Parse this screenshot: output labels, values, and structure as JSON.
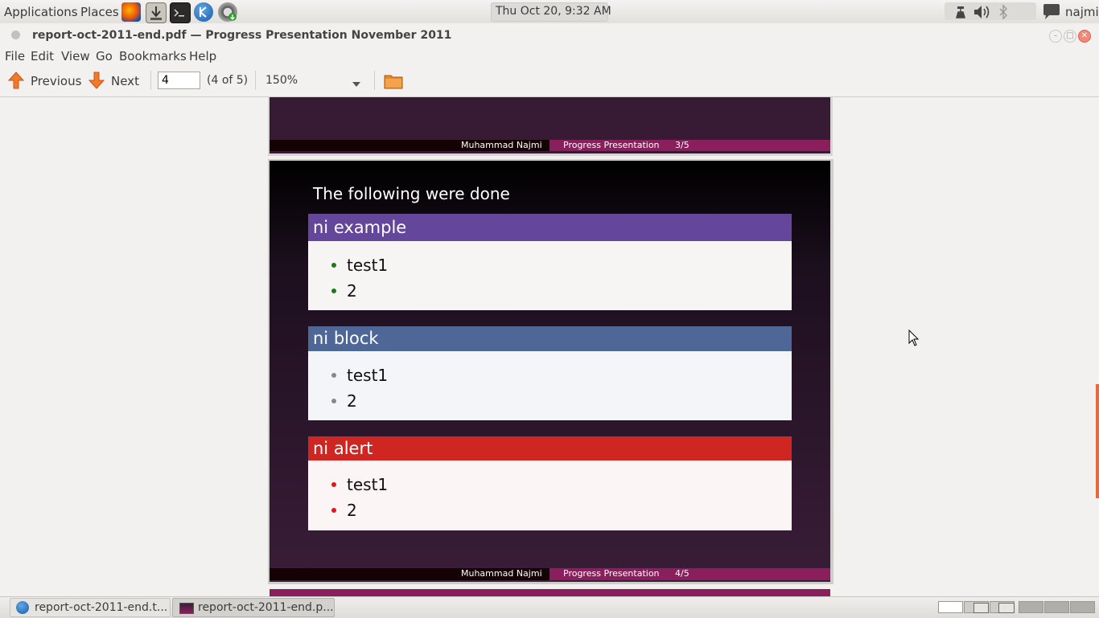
{
  "top_panel": {
    "menus": [
      "Applications",
      "Places"
    ],
    "clock": "Thu Oct 20,  9:32 AM",
    "user": "najmi"
  },
  "window": {
    "title": "report-oct-2011-end.pdf — Progress Presentation November 2011"
  },
  "menubar": [
    "File",
    "Edit",
    "View",
    "Go",
    "Bookmarks",
    "Help"
  ],
  "toolbar": {
    "previous_label": "Previous",
    "next_label": "Next",
    "page_value": "4",
    "page_count": "(4 of 5)",
    "zoom": "150%"
  },
  "slide3": {
    "footer_author": "Muhammad Najmi",
    "footer_title": "Progress Presentation",
    "footer_page": "3/5"
  },
  "slide4": {
    "heading": "The following were done",
    "blocks": [
      {
        "title": "ni example",
        "items": [
          "test1",
          "2"
        ],
        "title_color": "#64479a",
        "bullet_color": "#1a7a1a"
      },
      {
        "title": "ni block",
        "items": [
          "test1",
          "2"
        ],
        "title_color": "#4e6797",
        "bullet_color": "#888888"
      },
      {
        "title": "ni alert",
        "items": [
          "test1",
          "2"
        ],
        "title_color": "#d02622",
        "bullet_color": "#e01818"
      }
    ],
    "footer_author": "Muhammad Najmi",
    "footer_title": "Progress Presentation",
    "footer_page": "4/5"
  },
  "taskbar": {
    "tasks": [
      "report-oct-2011-end.t...",
      "report-oct-2011-end.p..."
    ]
  },
  "colors": {
    "accent_orange": "#e8693a",
    "footer_magenta": "#8b1e5c"
  }
}
